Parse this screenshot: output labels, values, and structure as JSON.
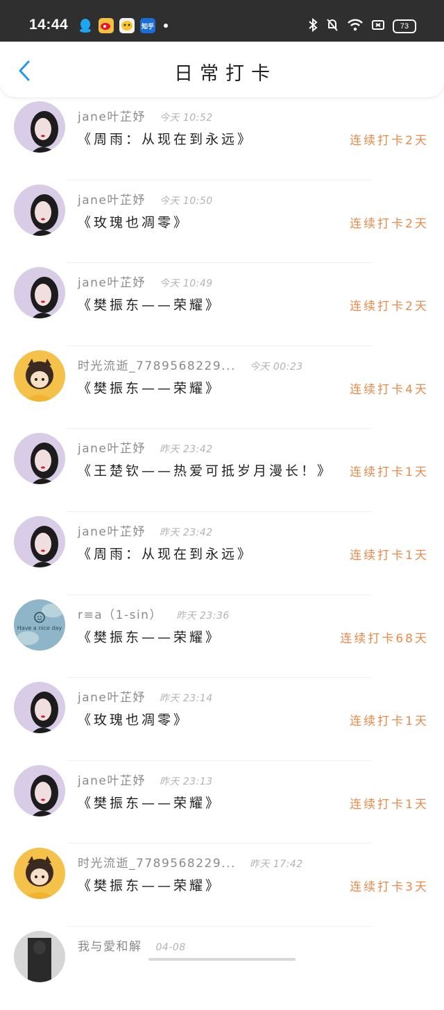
{
  "status_bar": {
    "time": "14:44",
    "apps": [
      "qq-icon",
      "weibo-icon",
      "taobao-icon",
      "zhihu-icon"
    ],
    "zhihu_label": "知乎",
    "battery": "73"
  },
  "header": {
    "title": "日常打卡",
    "back_icon": "chevron-left-icon",
    "accent": "#2196f3"
  },
  "colors": {
    "streak": "#ea8a4a",
    "username": "#8a8a8a",
    "time": "#b3b3b3"
  },
  "checkins": [
    {
      "user": "jane叶芷妤",
      "time": "今天 10:52",
      "song": "《周雨：从现在到永远》",
      "streak": "连续打卡2天",
      "avatar": "girl"
    },
    {
      "user": "jane叶芷妤",
      "time": "今天 10:50",
      "song": "《玫瑰也凋零》",
      "streak": "连续打卡2天",
      "avatar": "girl"
    },
    {
      "user": "jane叶芷妤",
      "time": "今天 10:49",
      "song": "《樊振东——荣耀》",
      "streak": "连续打卡2天",
      "avatar": "girl"
    },
    {
      "user": "时光流逝_7789568229...",
      "time": "今天 00:23",
      "song": "《樊振东——荣耀》",
      "streak": "连续打卡4天",
      "avatar": "anime"
    },
    {
      "user": "jane叶芷妤",
      "time": "昨天 23:42",
      "song": "《王楚钦——热爱可抵岁月漫长！》",
      "streak": "连续打卡1天",
      "avatar": "girl"
    },
    {
      "user": "jane叶芷妤",
      "time": "昨天 23:42",
      "song": "《周雨：从现在到永远》",
      "streak": "连续打卡1天",
      "avatar": "girl"
    },
    {
      "user": "r≡a（1-sin）",
      "time": "昨天 23:36",
      "song": "《樊振东——荣耀》",
      "streak": "连续打卡68天",
      "avatar": "nice-day"
    },
    {
      "user": "jane叶芷妤",
      "time": "昨天 23:14",
      "song": "《玫瑰也凋零》",
      "streak": "连续打卡1天",
      "avatar": "girl"
    },
    {
      "user": "jane叶芷妤",
      "time": "昨天 23:13",
      "song": "《樊振东——荣耀》",
      "streak": "连续打卡1天",
      "avatar": "girl"
    },
    {
      "user": "时光流逝_7789568229...",
      "time": "昨天 17:42",
      "song": "《樊振东——荣耀》",
      "streak": "连续打卡3天",
      "avatar": "anime"
    },
    {
      "user": "我与愛和解",
      "time": "04-08",
      "song": "",
      "streak": "",
      "avatar": "dark"
    }
  ],
  "avatar_text": {
    "nice_day": "Have a nice day"
  }
}
